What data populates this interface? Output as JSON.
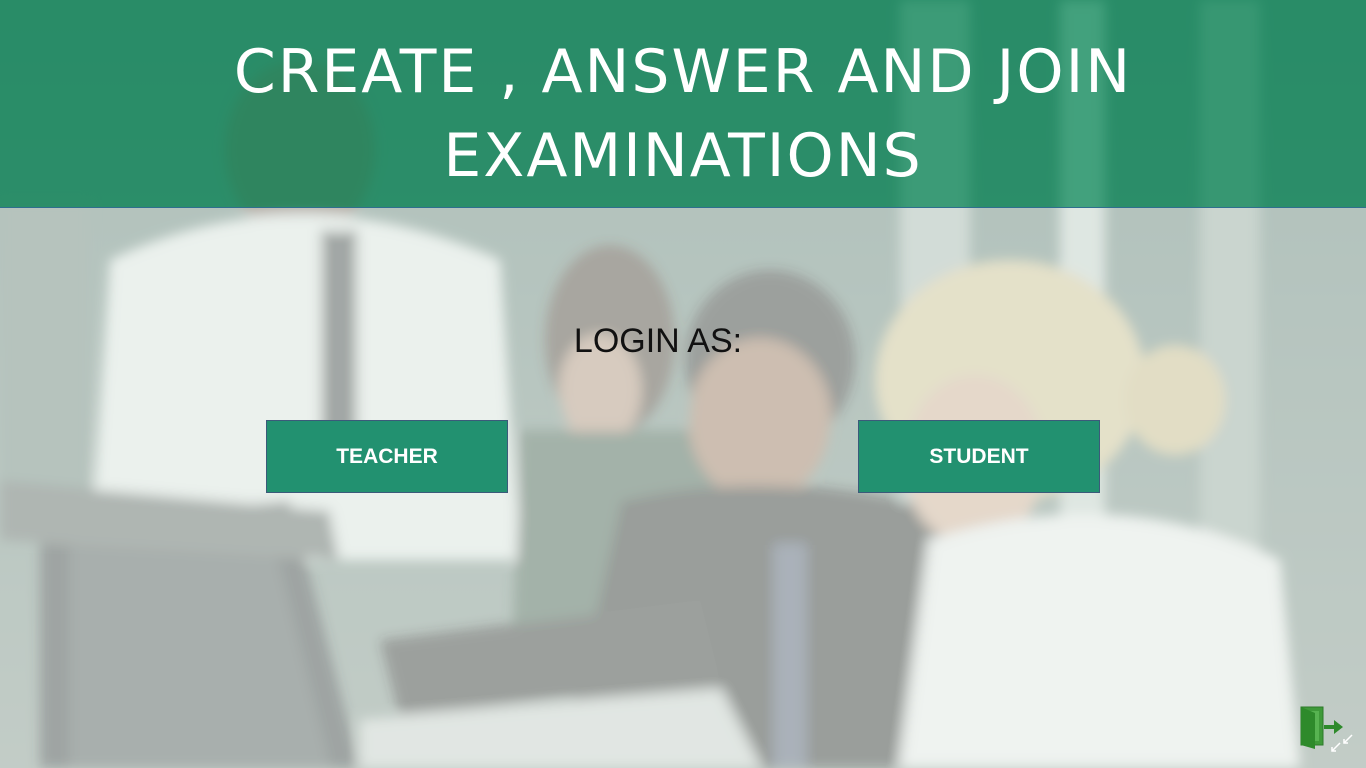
{
  "header": {
    "title_line1": "CREATE , ANSWER AND JOIN",
    "title_line2": "EXAMINATIONS"
  },
  "login": {
    "label": "LOGIN AS:",
    "teacher_label": "TEACHER",
    "student_label": "STUDENT"
  },
  "icons": {
    "exit": "exit-door-icon",
    "resize": "resize-arrows-icon"
  },
  "colors": {
    "header_band": "#209468",
    "button": "#229170",
    "button_border": "#3b5a7a",
    "title_text": "#ffffff",
    "label_text": "#111111"
  }
}
